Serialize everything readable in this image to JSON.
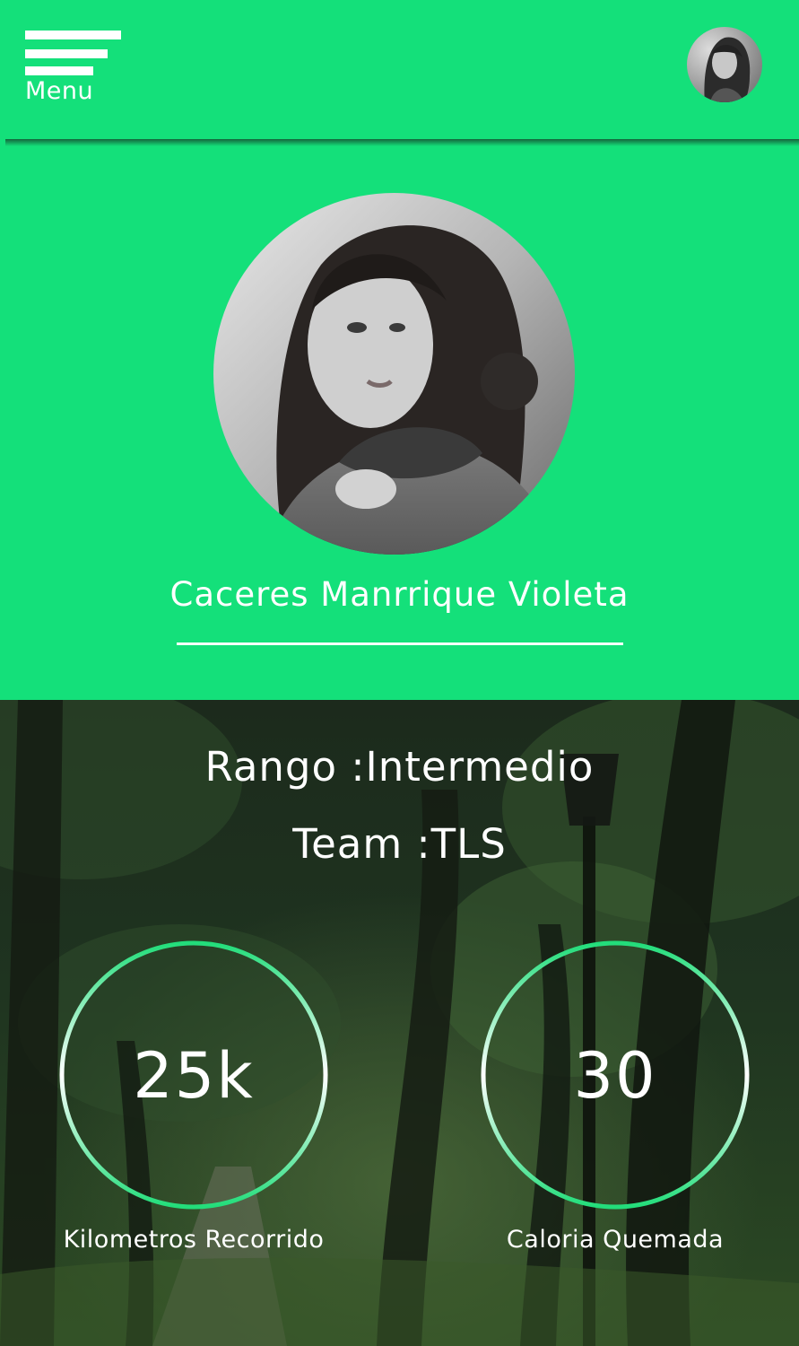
{
  "header": {
    "menu_label": "Menu"
  },
  "profile": {
    "name": "Caceres Manrrique Violeta"
  },
  "info": {
    "rank": "Rango :Intermedio",
    "team": "Team :TLS"
  },
  "stats": [
    {
      "value": "25k",
      "label": "Kilometros Recorrido"
    },
    {
      "value": "30",
      "label": "Caloria Quemada"
    }
  ],
  "colors": {
    "primary": "#14e07a",
    "text": "#ffffff",
    "ring": "#1ee07c"
  }
}
